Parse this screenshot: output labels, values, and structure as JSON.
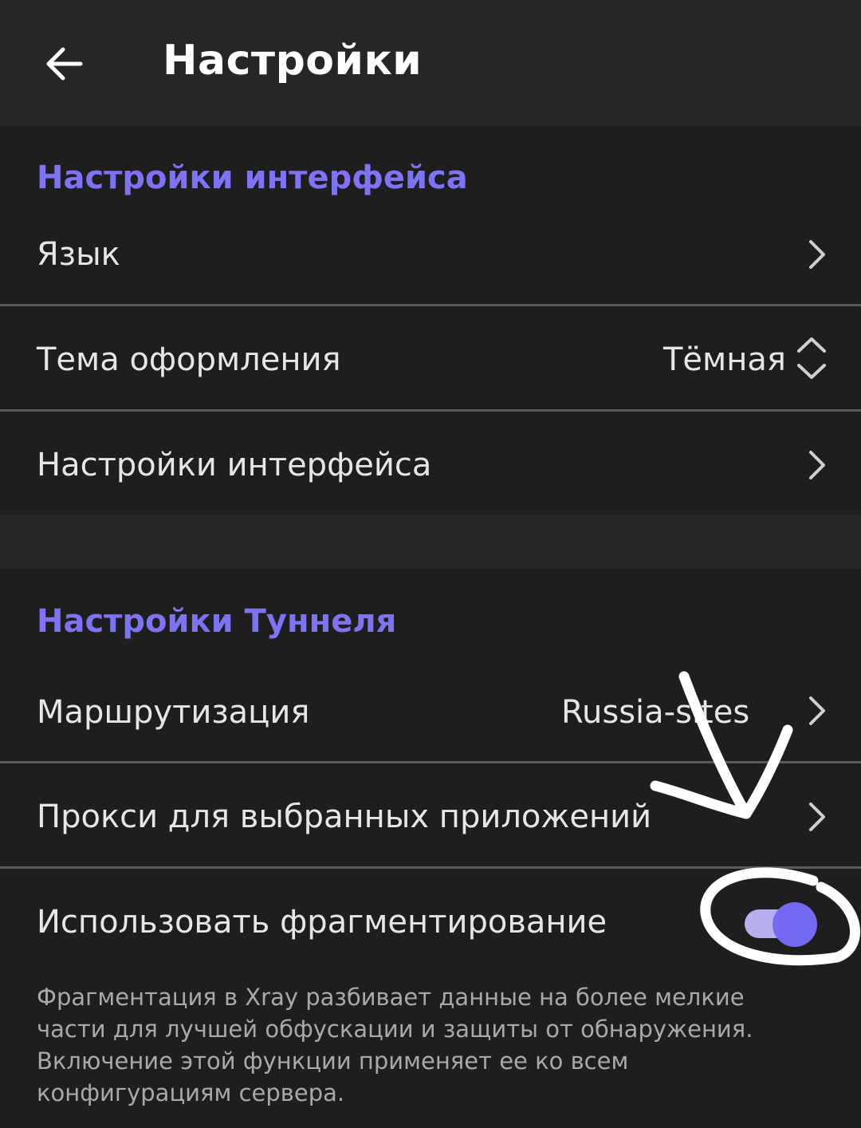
{
  "appbar": {
    "title": "Настройки",
    "back_icon": "arrow-left-icon"
  },
  "sections": {
    "interface": {
      "header": "Настройки интерфейса",
      "language_label": "Язык",
      "theme_label": "Тема оформления",
      "theme_value": "Тёмная",
      "interface_settings_label": "Настройки интерфейса"
    },
    "tunnel": {
      "header": "Настройки Туннеля",
      "routing_label": "Маршрутизация",
      "routing_value": "Russia-sites",
      "per_app_proxy_label": "Прокси для выбранных приложений",
      "fragmentation_label": "Использовать фрагментирование",
      "fragmentation_enabled": true,
      "fragmentation_description": "Фрагментация в Xray разбивает данные на более мелкие части для лучшей обфускации и защиты от обнаружения. Включение этой функции применяет ее ко всем конфигурациям сервера."
    }
  },
  "colors": {
    "accent": "#7d73f4",
    "toggle_thumb": "#7569f2",
    "toggle_track": "#b6b1ee",
    "background": "#1e1e1e",
    "appbar": "#262626"
  }
}
